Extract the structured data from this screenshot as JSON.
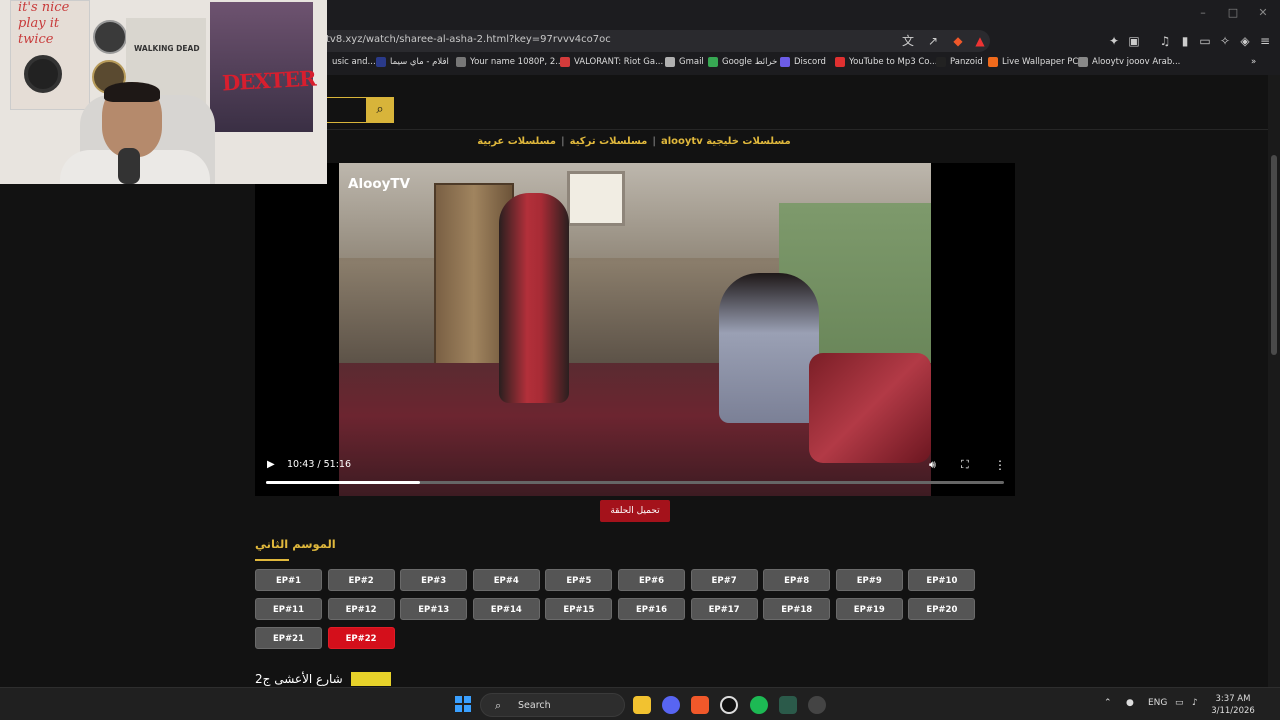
{
  "browser": {
    "url": "tv8.xyz/watch/sharee-al-asha-2.html?key=97rvvv4co7oc",
    "bookmarks": [
      {
        "label": "usic and...",
        "color": "#1c1c1f"
      },
      {
        "label": "افلام - ماي سيما",
        "color": "#2a3a8a"
      },
      {
        "label": "Your name 1080P, 2...",
        "color": "#777777"
      },
      {
        "label": "VALORANT: Riot Ga...",
        "color": "#d33b3b"
      },
      {
        "label": "Gmail",
        "color": "#b0b0b0"
      },
      {
        "label": "Google خرائط",
        "color": "#37a853"
      },
      {
        "label": "Discord",
        "color": "#6c5ce7"
      },
      {
        "label": "YouTube to Mp3 Co...",
        "color": "#e03030"
      },
      {
        "label": "Panzoid",
        "color": "#222222"
      },
      {
        "label": "Live Wallpaper PC",
        "color": "#f06a1c"
      },
      {
        "label": "Alooytv jooov Arab...",
        "color": "#888888"
      }
    ],
    "window_controls": {
      "minimize": "–",
      "maximize": "□",
      "close": "✕"
    }
  },
  "site": {
    "search_placeholder": "",
    "nav": {
      "item1": "alooytv مسلسلات خليجية",
      "item2": "مسلسلات عربية",
      "item3": "مسلسلات تركية"
    }
  },
  "player": {
    "watermark": "AlooyTV",
    "time": "10:43 / 51:16",
    "progress_fraction": 0.209,
    "download_label": "تحميل الحلقة"
  },
  "season": {
    "title": "الموسم الثاني",
    "episodes": [
      "EP#1",
      "EP#2",
      "EP#3",
      "EP#4",
      "EP#5",
      "EP#6",
      "EP#7",
      "EP#8",
      "EP#9",
      "EP#10",
      "EP#11",
      "EP#12",
      "EP#13",
      "EP#14",
      "EP#15",
      "EP#16",
      "EP#17",
      "EP#18",
      "EP#19",
      "EP#20",
      "EP#21",
      "EP#22"
    ],
    "active_episode": "EP#22"
  },
  "series": {
    "title": "شارع الأعشى ج2"
  },
  "webcam": {
    "poster1_text": "it's nice play it twice",
    "poster2_text": "WALKING DEAD",
    "poster3_text": "DEXTER"
  },
  "taskbar": {
    "search_label": "Search",
    "lang": "ENG",
    "time": "3:37 AM",
    "date": "3/11/2026"
  },
  "colors": {
    "accent_gold": "#e0b83c",
    "active_red": "#d40f1b",
    "download_red": "#a4121b"
  }
}
